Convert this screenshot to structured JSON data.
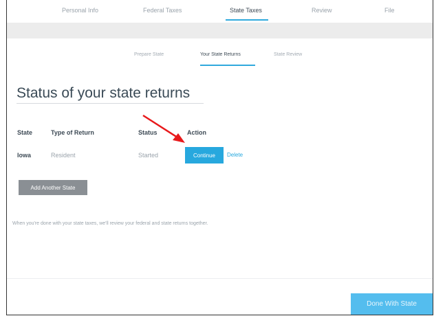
{
  "top_nav": {
    "tabs": [
      {
        "label": "Personal Info"
      },
      {
        "label": "Federal Taxes"
      },
      {
        "label": "State Taxes"
      },
      {
        "label": "Review"
      },
      {
        "label": "File"
      }
    ],
    "active": "State Taxes"
  },
  "sub_nav": {
    "tabs": [
      {
        "label": "Prepare State"
      },
      {
        "label": "Your State Returns"
      },
      {
        "label": "State Review"
      }
    ],
    "active": "Your State Returns"
  },
  "main": {
    "title": "Status of your state returns",
    "table": {
      "headers": [
        "State",
        "Type of Return",
        "Status",
        "Action"
      ],
      "rows": [
        {
          "state": "Iowa",
          "type": "Resident",
          "status": "Started",
          "action_primary": "Continue",
          "action_secondary": "Delete"
        }
      ]
    },
    "add_button": "Add Another State",
    "note": "When you're done with your state taxes, we'll review your federal and state returns together.",
    "done_button": "Done With State"
  },
  "colors": {
    "accent": "#27a8de",
    "arrow": "#e8191b",
    "add_button": "#8a8f94"
  }
}
